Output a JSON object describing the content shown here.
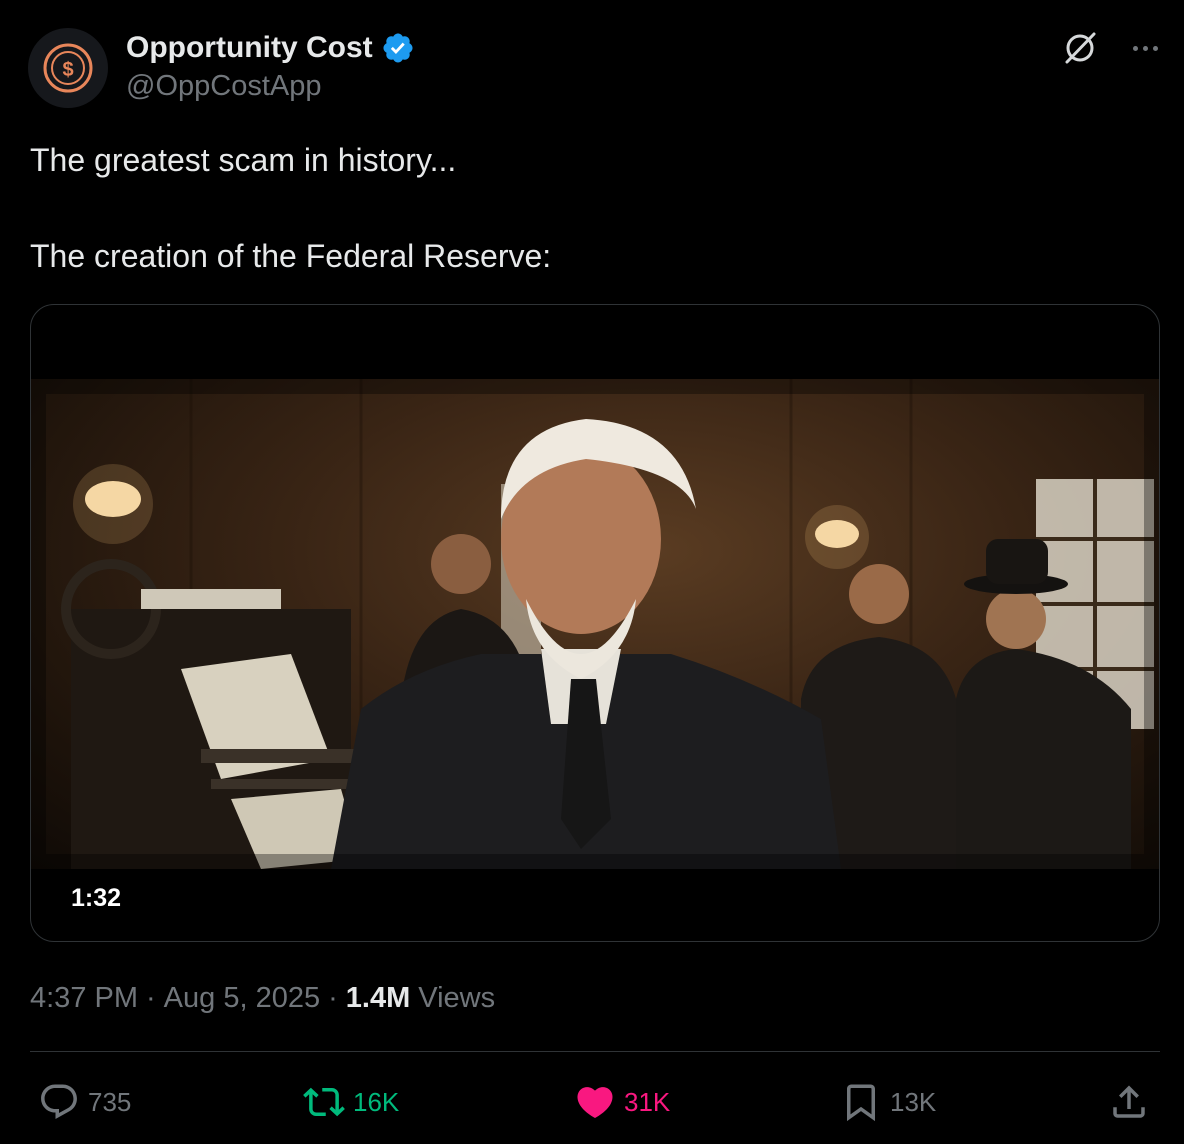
{
  "author": {
    "name": "Opportunity Cost",
    "handle": "@OppCostApp",
    "verified": true,
    "avatar_symbol": "$",
    "avatar_color": "#e8865a"
  },
  "tweet": {
    "lines": [
      "The greatest scam in history...",
      "The creation of the Federal Reserve:"
    ]
  },
  "media": {
    "type": "video",
    "duration": "1:32"
  },
  "meta": {
    "time": "4:37 PM",
    "date": "Aug 5, 2025",
    "views_count": "1.4M",
    "views_label": "Views",
    "separator": "·"
  },
  "actions": {
    "replies": "735",
    "reposts": "16K",
    "likes": "31K",
    "bookmarks": "13K"
  },
  "colors": {
    "background": "#000000",
    "text_primary": "#e7e9ea",
    "text_secondary": "#71767b",
    "verified_blue": "#1d9bf0",
    "repost_green": "#00ba7c",
    "like_pink": "#f91880",
    "divider": "#2f3336"
  },
  "icons": {
    "verified": "verified-badge-icon",
    "grok": "grok-icon",
    "more": "more-dots-icon",
    "reply": "reply-icon",
    "repost": "repost-icon",
    "like": "heart-icon",
    "bookmark": "bookmark-icon",
    "share": "share-icon"
  }
}
